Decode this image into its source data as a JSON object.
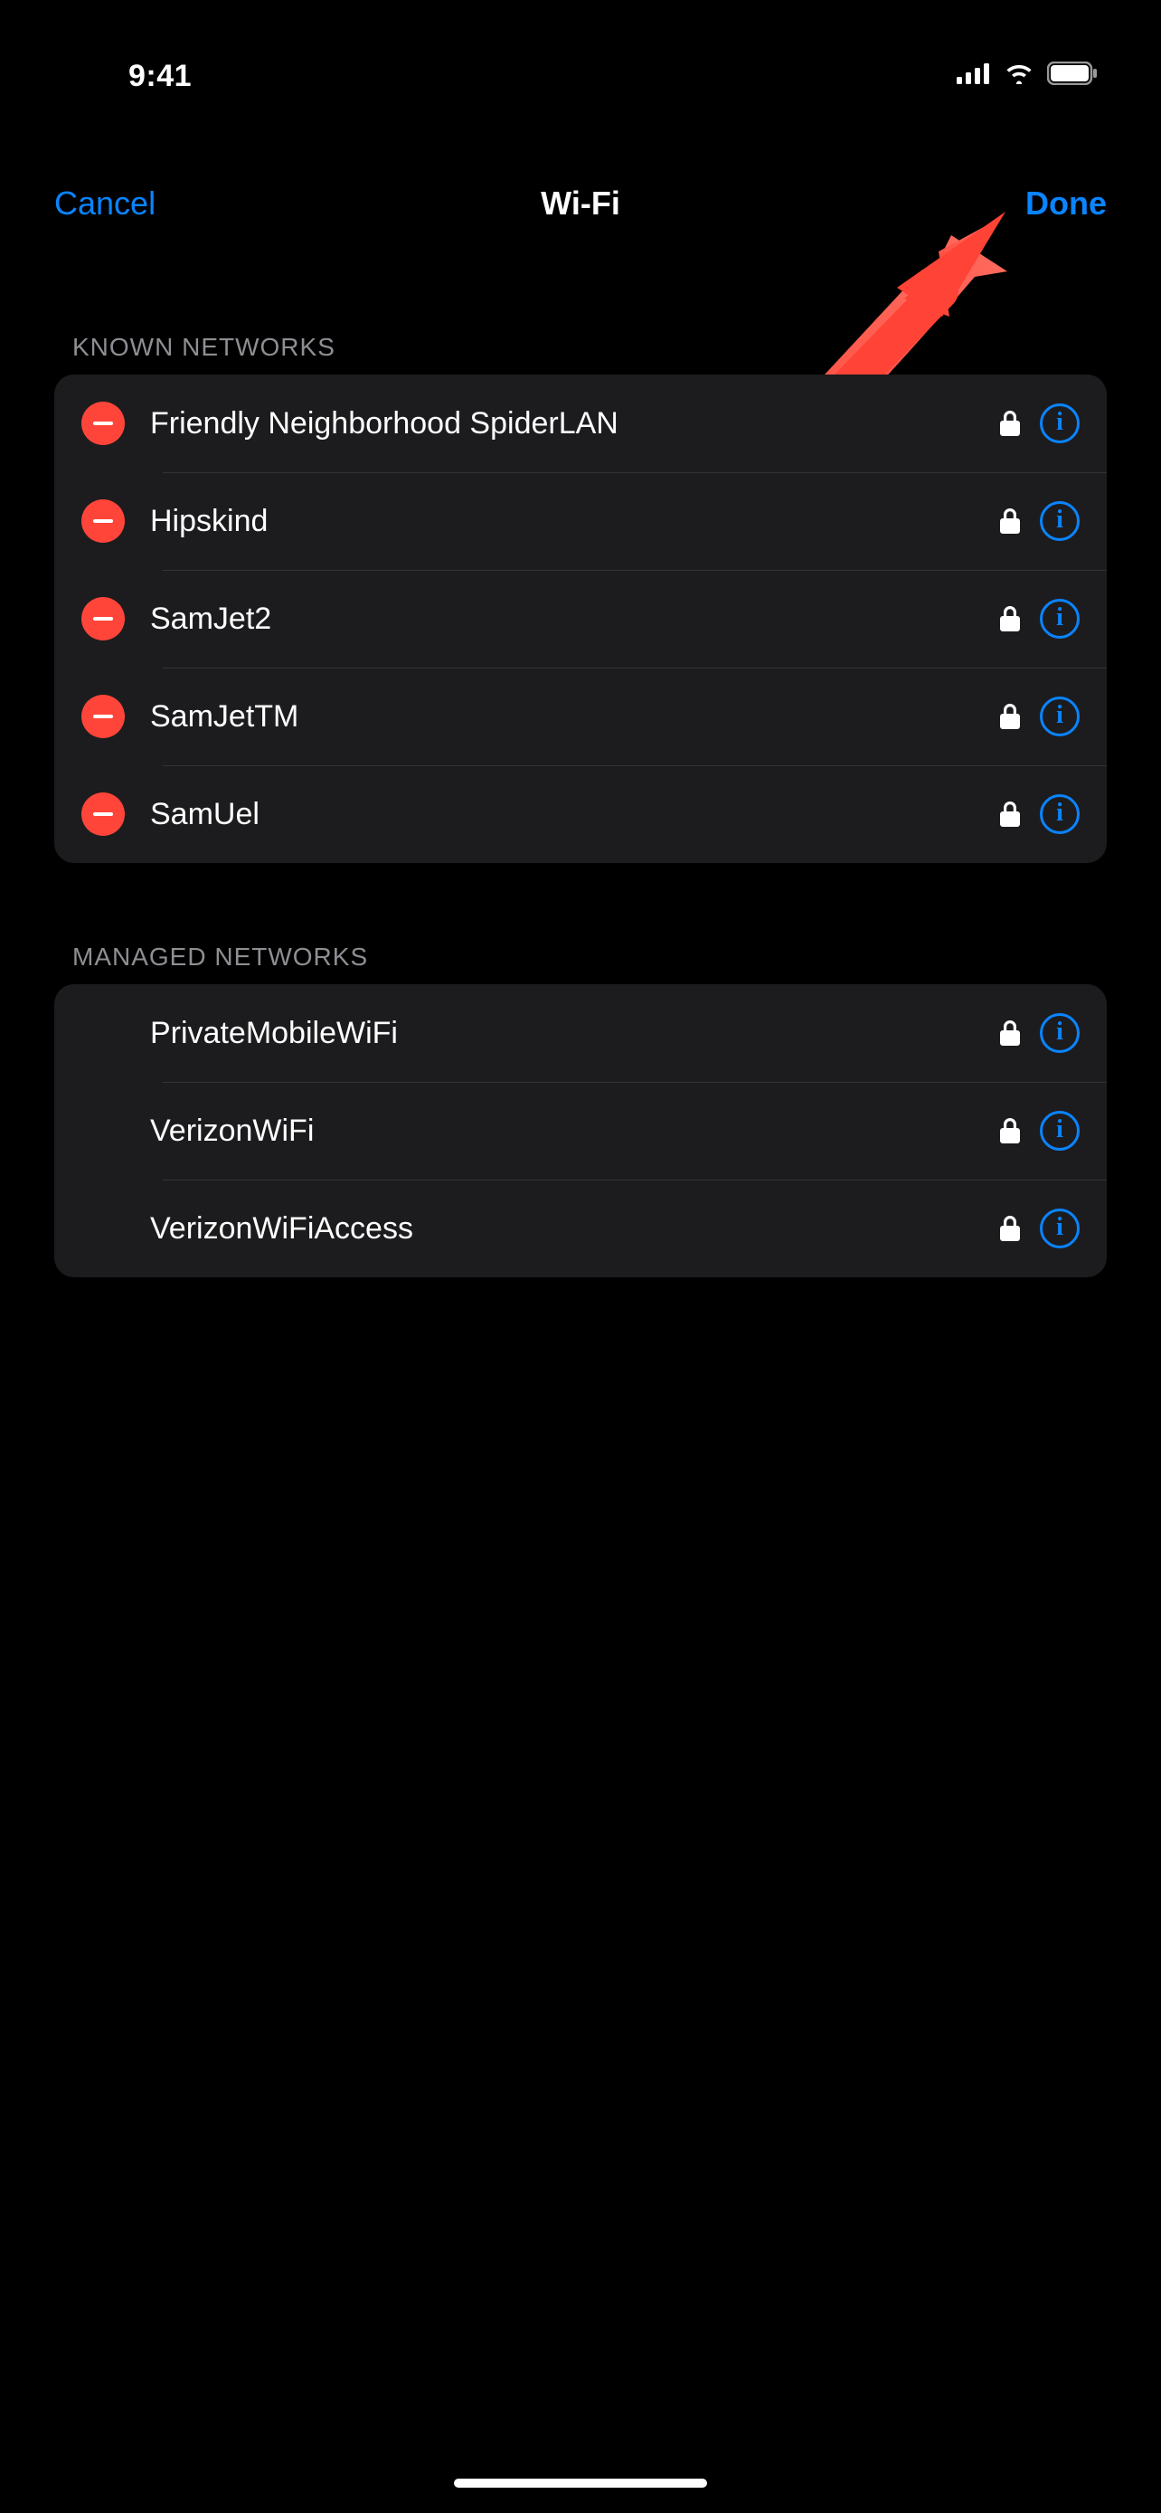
{
  "statusbar": {
    "time": "9:41"
  },
  "nav": {
    "cancel": "Cancel",
    "title": "Wi-Fi",
    "done": "Done"
  },
  "sections": {
    "known": {
      "header": "KNOWN NETWORKS",
      "items": [
        {
          "name": "Friendly Neighborhood SpiderLAN",
          "locked": true
        },
        {
          "name": "Hipskind",
          "locked": true
        },
        {
          "name": "SamJet2",
          "locked": true
        },
        {
          "name": "SamJetTM",
          "locked": true
        },
        {
          "name": "SamUel",
          "locked": true
        }
      ]
    },
    "managed": {
      "header": "MANAGED NETWORKS",
      "items": [
        {
          "name": "PrivateMobileWiFi",
          "locked": true
        },
        {
          "name": "VerizonWiFi",
          "locked": true
        },
        {
          "name": "VerizonWiFiAccess",
          "locked": true
        }
      ]
    }
  },
  "colors": {
    "accent": "#0a84ff",
    "danger": "#ff453a",
    "group_bg": "#1c1c1e",
    "muted_text": "#8e8e93"
  }
}
